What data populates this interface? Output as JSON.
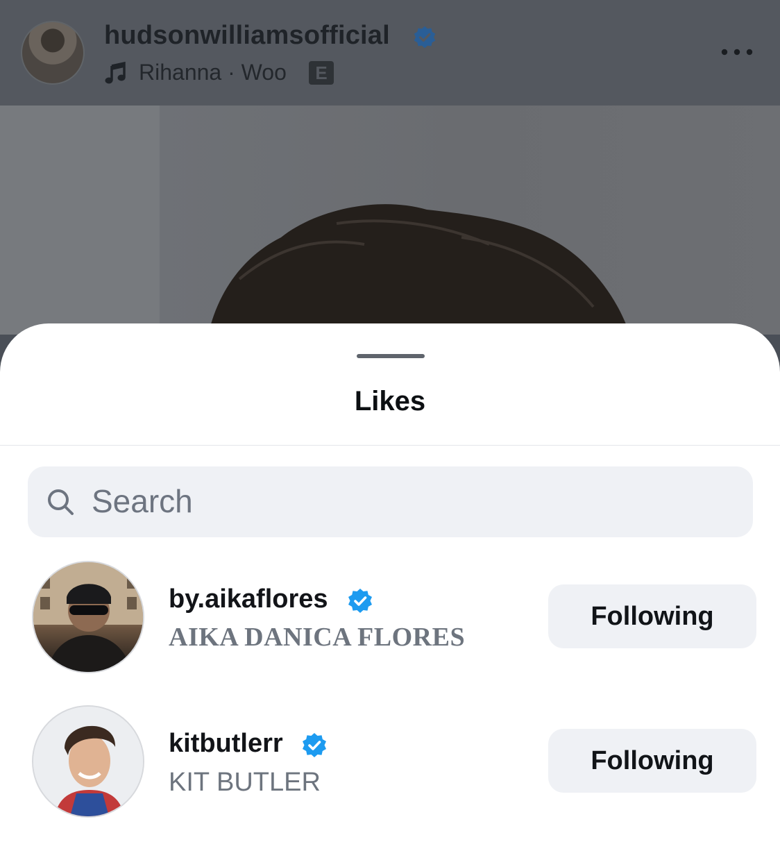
{
  "post": {
    "username": "hudsonwilliamsofficial",
    "track": "Rihanna · Woo",
    "explicit_badge": "E"
  },
  "sheet": {
    "title": "Likes",
    "search": {
      "placeholder": "Search",
      "value": ""
    }
  },
  "users": [
    {
      "username": "by.aikaflores",
      "full_name": "AIKA DANICA FLORES",
      "verified": true,
      "button": "Following"
    },
    {
      "username": "kitbutlerr",
      "full_name": "KIT BUTLER",
      "verified": true,
      "button": "Following"
    }
  ],
  "colors": {
    "verified_blue": "#1d9bf0",
    "dim_overlay": "#54585f",
    "button_bg": "#eff1f5"
  },
  "icons": [
    "verified-badge-icon",
    "music-note-icon",
    "more-options-icon",
    "search-icon"
  ]
}
